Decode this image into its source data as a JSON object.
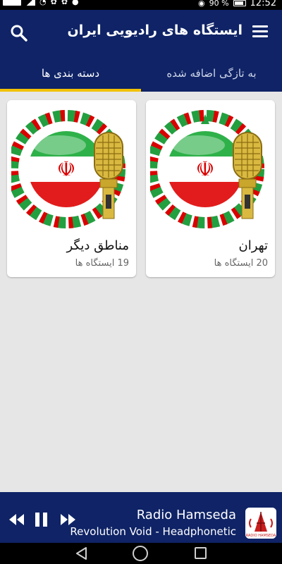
{
  "status_bar": {
    "battery": "90 %",
    "time": "12:52"
  },
  "app_title": "ایستگاه های رادیویی ایران",
  "tabs": [
    {
      "label": "دسته بندی ها",
      "active": true
    },
    {
      "label": "به تازگی اضافه شده",
      "active": false
    }
  ],
  "categories": [
    {
      "title": "تهران",
      "count": "20 ایستگاه ها"
    },
    {
      "title": "مناطق دیگر",
      "count": "19 ایستگاه ها"
    }
  ],
  "player": {
    "station": "Radio Hamseda",
    "track": "Revolution Void - Headphonetic",
    "state": "playing",
    "logo_text": "RADIO HAMSEDA"
  },
  "colors": {
    "app_bar": "#0f2366",
    "tab_indicator": "#f2c200",
    "background": "#e6e6e6"
  },
  "icons": [
    "search-icon",
    "menu-icon",
    "iran-flag-microphone-icon",
    "previous-icon",
    "pause-icon",
    "next-icon",
    "back-icon",
    "home-icon",
    "recents-icon"
  ]
}
